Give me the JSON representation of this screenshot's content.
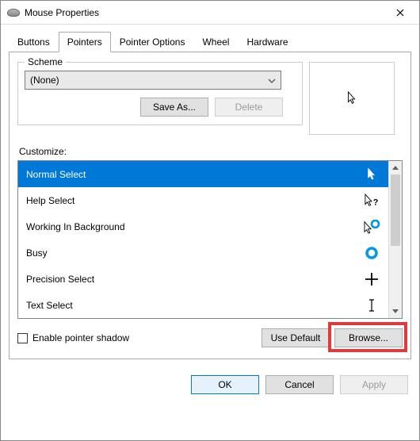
{
  "window": {
    "title": "Mouse Properties"
  },
  "tabs": [
    "Buttons",
    "Pointers",
    "Pointer Options",
    "Wheel",
    "Hardware"
  ],
  "active_tab": 1,
  "scheme": {
    "legend": "Scheme",
    "selected": "(None)",
    "save_as": "Save As...",
    "delete": "Delete"
  },
  "customize_label": "Customize:",
  "items": [
    {
      "label": "Normal Select",
      "icon": "arrow-white",
      "selected": true
    },
    {
      "label": "Help Select",
      "icon": "arrow-help",
      "selected": false
    },
    {
      "label": "Working In Background",
      "icon": "arrow-ring",
      "selected": false
    },
    {
      "label": "Busy",
      "icon": "ring",
      "selected": false
    },
    {
      "label": "Precision Select",
      "icon": "cross",
      "selected": false
    },
    {
      "label": "Text Select",
      "icon": "ibeam",
      "selected": false
    }
  ],
  "shadow_label": "Enable pointer shadow",
  "use_default": "Use Default",
  "browse": "Browse...",
  "footer": {
    "ok": "OK",
    "cancel": "Cancel",
    "apply": "Apply"
  }
}
